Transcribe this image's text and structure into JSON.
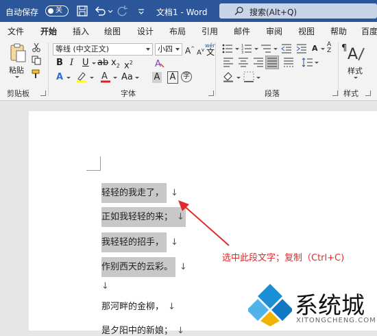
{
  "titlebar": {
    "autosave_label": "自动保存",
    "autosave_state": "关",
    "document_title": "文档1  -  Word",
    "search_placeholder": "搜索(Alt+Q)"
  },
  "tabs": [
    "文件",
    "开始",
    "插入",
    "绘图",
    "设计",
    "布局",
    "引用",
    "邮件",
    "审阅",
    "视图",
    "帮助",
    "百度"
  ],
  "active_tab": "开始",
  "ribbon": {
    "clipboard": {
      "paste_label": "粘贴",
      "group_label": "剪贴板"
    },
    "font": {
      "font_name": "等线 (中文正文)",
      "font_size": "小四",
      "wen_label": "wén",
      "wen_char": "文",
      "group_label": "字体"
    },
    "paragraph": {
      "group_label": "段落"
    },
    "styles": {
      "styles_label": "样式",
      "group_label": "样式"
    }
  },
  "document": {
    "lines": [
      {
        "text": "轻轻的我走了，",
        "mark": "↓",
        "selected": true
      },
      {
        "text": "正如我轻轻的来；",
        "mark": "↓",
        "selected": true
      },
      {
        "text": "我轻轻的招手，",
        "mark": "↓",
        "selected": true
      },
      {
        "text": "作别西天的云彩。",
        "mark": "↓",
        "selected": true
      },
      {
        "text": "",
        "mark": "↓",
        "selected": false
      },
      {
        "text": "那河畔的金柳，",
        "mark": "↓",
        "selected": false
      },
      {
        "text": "是夕阳中的新娘；",
        "mark": "↓",
        "selected": false
      }
    ],
    "annotation": "选中此段文字；复制（Ctrl+C)"
  },
  "watermark": {
    "brand": "系统城",
    "sub": "XITONGCHENG.COM"
  },
  "colors": {
    "titlebar": "#2b579a",
    "annotation": "#e02a2a",
    "selection": "#c8c8c8"
  }
}
